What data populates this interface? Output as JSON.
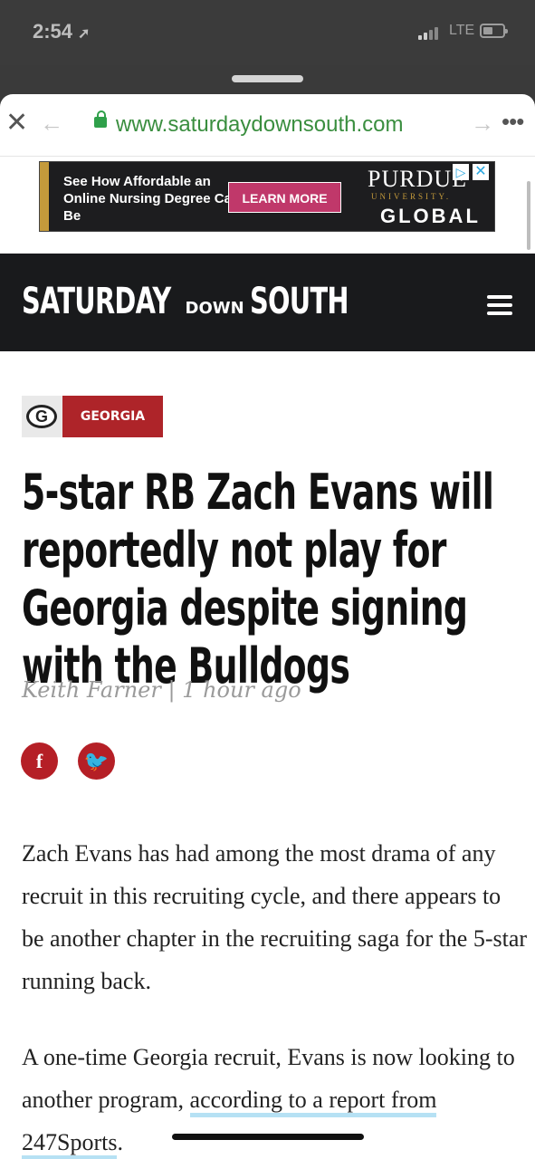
{
  "status_bar": {
    "time": "2:54",
    "network": "LTE"
  },
  "browser": {
    "url": "www.saturdaydownsouth.com",
    "icons": [
      "close-icon",
      "back-icon",
      "lock-icon",
      "forward-icon",
      "more-icon"
    ]
  },
  "ad": {
    "text": "See How Affordable an Online Nursing Degree Can Be",
    "button": "LEARN MORE",
    "brand_line1": "PURDUE",
    "brand_line2": "UNIVERSITY.",
    "brand_line3": "GLOBAL"
  },
  "site": {
    "logo_part1": "SATURDAY",
    "logo_part2": "DOWN",
    "logo_part3": "SOUTH",
    "header_bg": "#191a1c"
  },
  "article": {
    "category": "GEORGIA",
    "category_color": "#ae2429",
    "headline": "5-star RB Zach Evans will reportedly not play for Georgia despite signing with the Bulldogs",
    "byline": "Keith Farner | 1 hour ago",
    "social": [
      "facebook-icon",
      "twitter-icon"
    ],
    "paragraph1": "Zach Evans has had among the most drama of any recruit in this recruiting cycle, and there appears to be another chapter in the recruiting saga for the 5-star running back.",
    "paragraph2_start": "A one-time Georgia recruit, Evans is now looking to another program, ",
    "paragraph2_link": "according to a report from 247Sports",
    "paragraph2_end": "."
  }
}
